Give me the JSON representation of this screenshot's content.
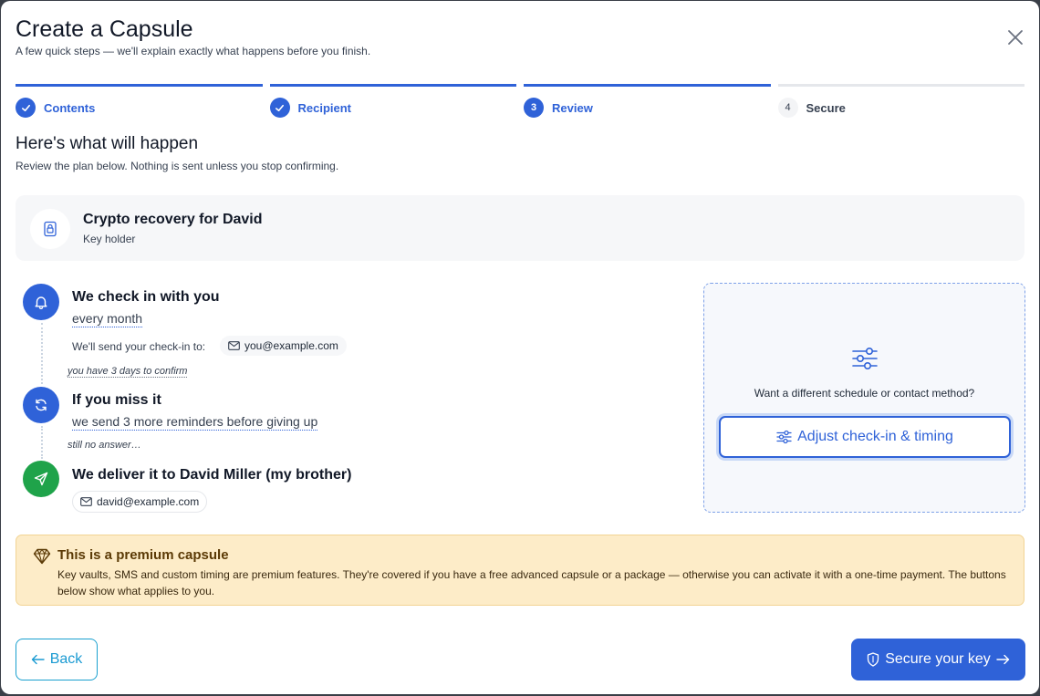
{
  "header": {
    "title": "Create a Capsule",
    "subtitle": "A few quick steps — we'll explain exactly what happens before you finish."
  },
  "stepper": [
    {
      "label": "Contents",
      "state": "done"
    },
    {
      "label": "Recipient",
      "state": "done"
    },
    {
      "label": "Review",
      "number": "3",
      "state": "current"
    },
    {
      "label": "Secure",
      "number": "4",
      "state": "pending"
    }
  ],
  "review": {
    "title": "Here's what will happen",
    "subtitle": "Review the plan below. Nothing is sent unless you stop confirming."
  },
  "capsule": {
    "name": "Crypto recovery for David",
    "role": "Key holder",
    "icon": "lock-icon"
  },
  "timeline": {
    "checkin": {
      "title": "We check in with you",
      "frequency": "every month",
      "send_label": "We'll send your check-in to:",
      "email": "you@example.com",
      "icon": "bell-icon"
    },
    "confirm_note": "you have 3 days to confirm",
    "miss": {
      "title": "If you miss it",
      "detail": "we send 3 more reminders before giving up",
      "icon": "refresh-icon"
    },
    "no_answer_note": "still no answer…",
    "deliver": {
      "title": "We deliver it to David Miller (my brother)",
      "email": "david@example.com",
      "icon": "send-icon"
    }
  },
  "adjust": {
    "prompt": "Want a different schedule or contact method?",
    "button": "Adjust check-in & timing"
  },
  "premium": {
    "title": "This is a premium capsule",
    "body": "Key vaults, SMS and custom timing are premium features. They're covered if you have a free advanced capsule or a package — otherwise you can activate it with a one-time payment. The buttons below show what applies to you."
  },
  "footer": {
    "back": "Back",
    "secure": "Secure your key"
  },
  "colors": {
    "primary": "#2f62d8",
    "success": "#1fa34a",
    "premium_bg": "#fdecc8",
    "back_accent": "#1a9ad2"
  }
}
